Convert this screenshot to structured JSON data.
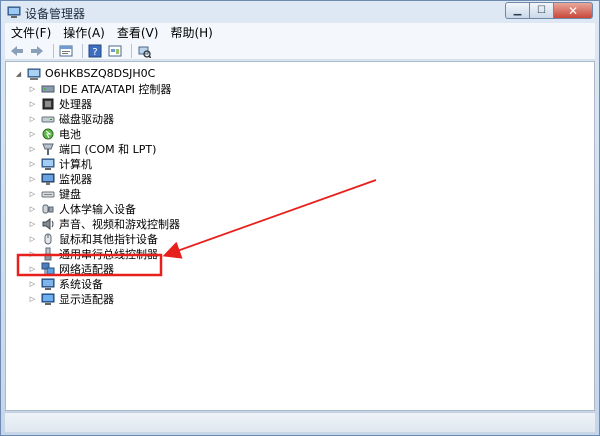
{
  "window": {
    "title": "设备管理器",
    "controls": {
      "minimize": "▁",
      "maximize": "☐",
      "close": "✕"
    }
  },
  "menu": [
    "文件(F)",
    "操作(A)",
    "查看(V)",
    "帮助(H)"
  ],
  "toolbar": {
    "buttons": [
      "back-icon",
      "forward-icon",
      "properties-icon",
      "help-icon",
      "show-hidden-icon",
      "scan-hardware-icon"
    ]
  },
  "tree": {
    "root": "O6HKBSZQ8DSJH0C",
    "items": [
      {
        "label": "IDE ATA/ATAPI 控制器",
        "icon": "ide-controller-icon"
      },
      {
        "label": "处理器",
        "icon": "processor-icon"
      },
      {
        "label": "磁盘驱动器",
        "icon": "disk-drive-icon"
      },
      {
        "label": "电池",
        "icon": "battery-icon"
      },
      {
        "label": "端口 (COM 和 LPT)",
        "icon": "port-icon"
      },
      {
        "label": "计算机",
        "icon": "computer-icon"
      },
      {
        "label": "监视器",
        "icon": "monitor-icon"
      },
      {
        "label": "键盘",
        "icon": "keyboard-icon"
      },
      {
        "label": "人体学输入设备",
        "icon": "hid-icon"
      },
      {
        "label": "声音、视频和游戏控制器",
        "icon": "sound-icon"
      },
      {
        "label": "鼠标和其他指针设备",
        "icon": "mouse-icon"
      },
      {
        "label": "通用串行总线控制器",
        "icon": "usb-icon"
      },
      {
        "label": "网络适配器",
        "icon": "network-adapter-icon"
      },
      {
        "label": "系统设备",
        "icon": "system-device-icon"
      },
      {
        "label": "显示适配器",
        "icon": "display-adapter-icon"
      }
    ]
  },
  "annotation": {
    "highlight_color": "#e8201c"
  }
}
